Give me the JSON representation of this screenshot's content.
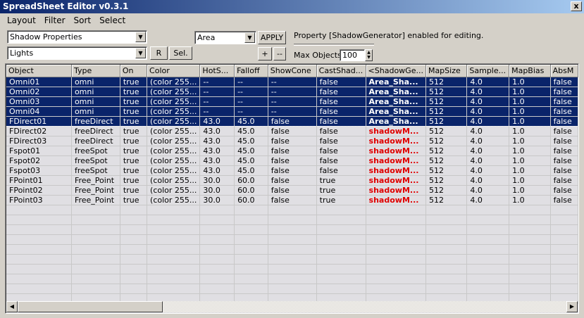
{
  "window": {
    "title": "SpreadSheet Editor v0.3.1",
    "close_glyph": "x"
  },
  "menu": [
    "Layout",
    "Filter",
    "Sort",
    "Select"
  ],
  "toolbar": {
    "property_set": "Shadow Properties",
    "object_filter": "Lights",
    "r_label": "R",
    "sel_label": "Sel.",
    "shadow_type": "Area",
    "apply_label": "APPLY",
    "plus_label": "+",
    "minus_label": "--",
    "status_text": "Property [ShadowGenerator] enabled for editing.",
    "max_objects_label": "Max Objects:",
    "max_objects_value": "100"
  },
  "icons": {
    "dropdown": "dropdown-arrow-icon",
    "scroll_left": "scroll-left-icon",
    "scroll_right": "scroll-right-icon"
  },
  "grid": {
    "columns": [
      "Object",
      "Type",
      "On",
      "Color",
      "HotS...",
      "Falloff",
      "ShowCone",
      "CastShad...",
      "<ShadowGe...",
      "MapSize",
      "Sample...",
      "MapBias",
      "AbsM"
    ],
    "rows": [
      {
        "state": "selected",
        "cells": [
          "Omni01",
          "omni",
          "true",
          "(color 255...",
          "--",
          "--",
          "--",
          "false",
          "Area_Sha...",
          "512",
          "4.0",
          "1.0",
          "false"
        ]
      },
      {
        "state": "selected",
        "cells": [
          "Omni02",
          "omni",
          "true",
          "(color 255...",
          "--",
          "--",
          "--",
          "false",
          "Area_Sha...",
          "512",
          "4.0",
          "1.0",
          "false"
        ]
      },
      {
        "state": "selected",
        "cells": [
          "Omni03",
          "omni",
          "true",
          "(color 255...",
          "--",
          "--",
          "--",
          "false",
          "Area_Sha...",
          "512",
          "4.0",
          "1.0",
          "false"
        ]
      },
      {
        "state": "selected",
        "cells": [
          "Omni04",
          "omni",
          "true",
          "(color 255...",
          "--",
          "--",
          "--",
          "false",
          "Area_Sha...",
          "512",
          "4.0",
          "1.0",
          "false"
        ]
      },
      {
        "state": "selected",
        "cells": [
          "FDirect01",
          "freeDirect",
          "true",
          "(color 255...",
          "43.0",
          "45.0",
          "false",
          "false",
          "Area_Sha...",
          "512",
          "4.0",
          "1.0",
          "false"
        ]
      },
      {
        "state": "normal",
        "cells": [
          "FDirect02",
          "freeDirect",
          "true",
          "(color 255...",
          "43.0",
          "45.0",
          "false",
          "false",
          "shadowM...",
          "512",
          "4.0",
          "1.0",
          "false"
        ]
      },
      {
        "state": "normal",
        "cells": [
          "FDirect03",
          "freeDirect",
          "true",
          "(color 255...",
          "43.0",
          "45.0",
          "false",
          "false",
          "shadowM...",
          "512",
          "4.0",
          "1.0",
          "false"
        ]
      },
      {
        "state": "normal",
        "cells": [
          "Fspot01",
          "freeSpot",
          "true",
          "(color 255...",
          "43.0",
          "45.0",
          "false",
          "false",
          "shadowM...",
          "512",
          "4.0",
          "1.0",
          "false"
        ]
      },
      {
        "state": "normal",
        "cells": [
          "Fspot02",
          "freeSpot",
          "true",
          "(color 255...",
          "43.0",
          "45.0",
          "false",
          "false",
          "shadowM...",
          "512",
          "4.0",
          "1.0",
          "false"
        ]
      },
      {
        "state": "normal",
        "cells": [
          "Fspot03",
          "freeSpot",
          "true",
          "(color 255...",
          "43.0",
          "45.0",
          "false",
          "false",
          "shadowM...",
          "512",
          "4.0",
          "1.0",
          "false"
        ]
      },
      {
        "state": "normal",
        "cells": [
          "FPoint01",
          "Free_Point",
          "true",
          "(color 255...",
          "30.0",
          "60.0",
          "false",
          "true",
          "shadowM...",
          "512",
          "4.0",
          "1.0",
          "false"
        ]
      },
      {
        "state": "normal",
        "cells": [
          "FPoint02",
          "Free_Point",
          "true",
          "(color 255...",
          "30.0",
          "60.0",
          "false",
          "true",
          "shadowM...",
          "512",
          "4.0",
          "1.0",
          "false"
        ]
      },
      {
        "state": "normal",
        "cells": [
          "FPoint03",
          "Free_Point",
          "true",
          "(color 255...",
          "30.0",
          "60.0",
          "false",
          "true",
          "shadowM...",
          "512",
          "4.0",
          "1.0",
          "false"
        ]
      }
    ],
    "empty_rows": 10
  },
  "colors": {
    "selection": "#0a246a",
    "shadow_highlight": "#e00000",
    "face": "#d4d0c8"
  }
}
